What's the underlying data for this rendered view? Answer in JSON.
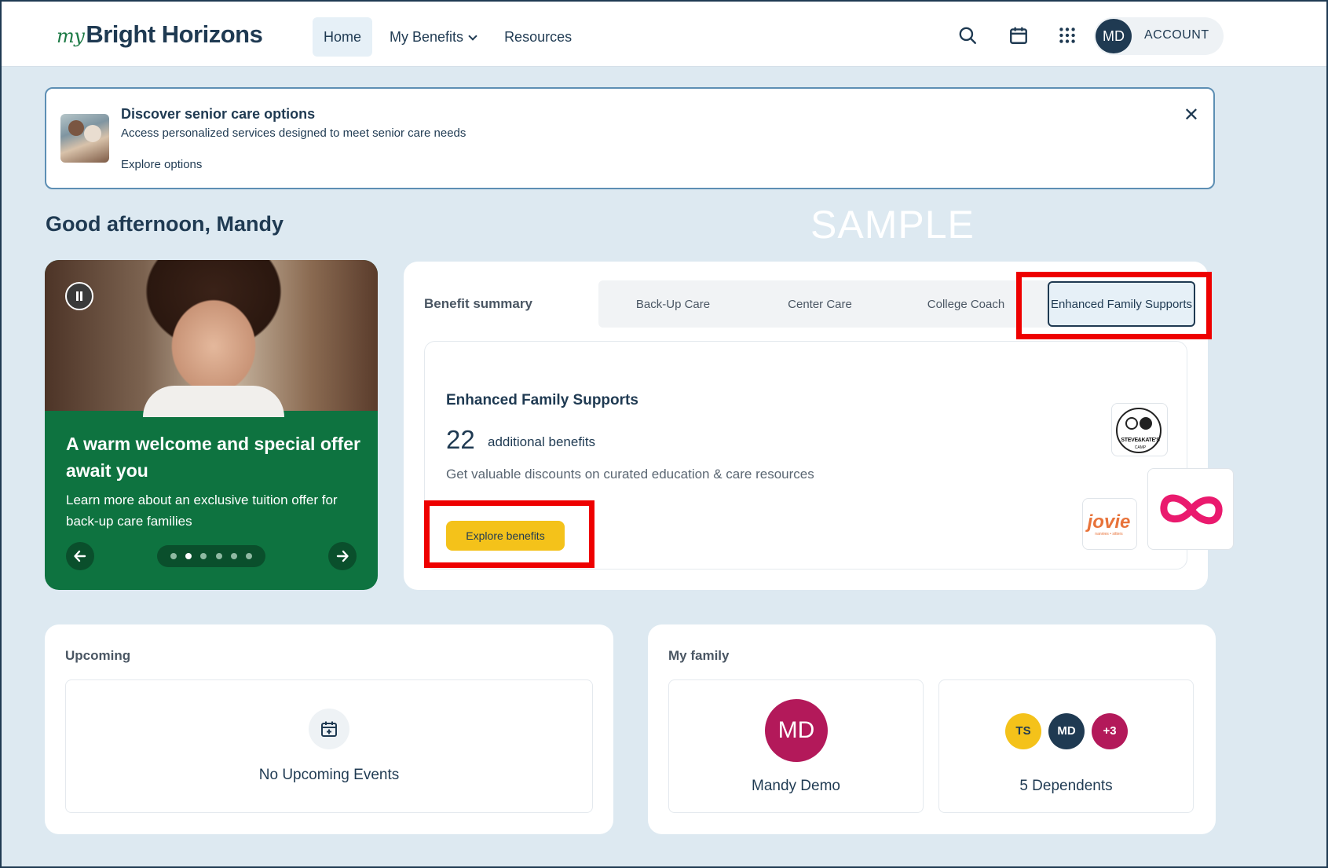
{
  "header": {
    "logo_my": "my",
    "logo_text": "Bright Horizons",
    "nav": [
      {
        "label": "Home",
        "active": true
      },
      {
        "label": "My Benefits",
        "dropdown": true
      },
      {
        "label": "Resources"
      }
    ],
    "icons": [
      "search-icon",
      "calendar-icon",
      "apps-grid-icon"
    ],
    "account_initials": "MD",
    "account_label": "ACCOUNT"
  },
  "banner": {
    "title": "Discover senior care options",
    "description": "Access personalized services designed to meet senior care needs",
    "link": "Explore options",
    "close_icon": "close-icon"
  },
  "greeting": "Good afternoon, Mandy",
  "watermark": "SAMPLE",
  "promo": {
    "title": "A warm welcome and special offer await you",
    "description": "Learn more about an exclusive tuition offer for back-up care families",
    "slide_count": 6,
    "active_slide": 2
  },
  "benefit_summary": {
    "label": "Benefit summary",
    "tabs": [
      "Back-Up Care",
      "Center Care",
      "College Coach",
      "Enhanced Family Supports"
    ],
    "active_tab": "Enhanced Family Supports",
    "card": {
      "title": "Enhanced Family Supports",
      "count": "22",
      "count_label": "additional benefits",
      "description": "Get valuable discounts on curated education & care resources",
      "button": "Explore benefits"
    },
    "partners": {
      "steve_kate": "STEVE&KATE'S",
      "steve_kate_sub": "CAMP",
      "jovie": "jovie",
      "jovie_sub": "nannies • sitters"
    }
  },
  "upcoming": {
    "title": "Upcoming",
    "empty_text": "No Upcoming Events"
  },
  "family": {
    "title": "My family",
    "member_initials": "MD",
    "member_name": "Mandy Demo",
    "dependent_avatars": [
      {
        "initials": "TS",
        "color": "#f4c21a"
      },
      {
        "initials": "MD",
        "color": "#1f3a52"
      },
      {
        "initials": "+3",
        "color": "#b3195a"
      }
    ],
    "dependents_label": "5 Dependents"
  },
  "colors": {
    "navy": "#1f3a52",
    "green": "#0e7340",
    "yellow": "#f4c21a",
    "magenta": "#b3195a",
    "highlight_red": "#ee0000"
  }
}
